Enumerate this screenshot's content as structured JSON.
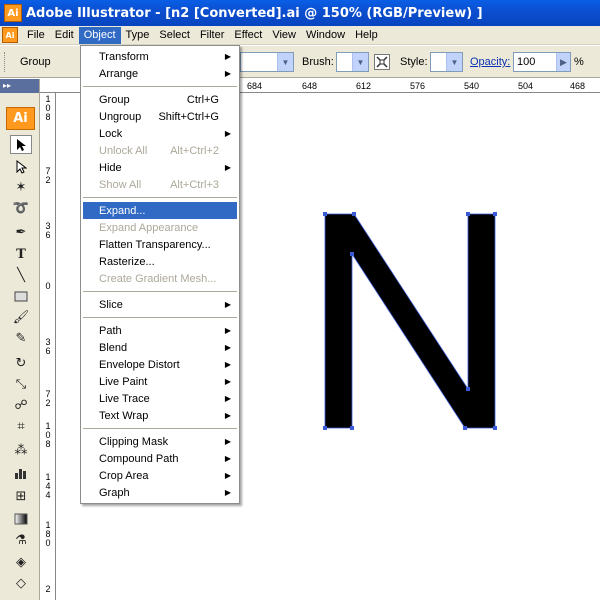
{
  "title": {
    "badge": "Ai",
    "text": "Adobe Illustrator - [n2 [Converted].ai @ 150% (RGB/Preview) ]"
  },
  "menubar": {
    "doc_badge": "Ai",
    "items": [
      "File",
      "Edit",
      "Object",
      "Type",
      "Select",
      "Filter",
      "Effect",
      "View",
      "Window",
      "Help"
    ],
    "active": "Object"
  },
  "controlbar": {
    "selection": "Group",
    "brush_label": "Brush:",
    "style_label": "Style:",
    "opacity_label": "Opacity:",
    "opacity_value": "100",
    "opacity_unit": "%"
  },
  "toolbox": {
    "logo": "Ai"
  },
  "ruler_top": [
    "684",
    "648",
    "612",
    "576",
    "540",
    "504",
    "468"
  ],
  "ruler_left": [
    [
      "1",
      "0",
      "8"
    ],
    [
      "7",
      "2"
    ],
    [
      "3",
      "6"
    ],
    [
      "0"
    ],
    [
      "3",
      "6"
    ],
    [
      "7",
      "2"
    ],
    [
      "1",
      "0",
      "8"
    ],
    [
      "1",
      "4",
      "4"
    ],
    [
      "1",
      "8",
      "0"
    ],
    [
      "2"
    ]
  ],
  "object_menu": {
    "groups": [
      [
        {
          "label": "Transform",
          "submenu": true
        },
        {
          "label": "Arrange",
          "submenu": true
        }
      ],
      [
        {
          "label": "Group",
          "shortcut": "Ctrl+G"
        },
        {
          "label": "Ungroup",
          "shortcut": "Shift+Ctrl+G"
        },
        {
          "label": "Lock",
          "submenu": true
        },
        {
          "label": "Unlock All",
          "shortcut": "Alt+Ctrl+2",
          "disabled": true
        },
        {
          "label": "Hide",
          "submenu": true
        },
        {
          "label": "Show All",
          "shortcut": "Alt+Ctrl+3",
          "disabled": true
        }
      ],
      [
        {
          "label": "Expand...",
          "highlighted": true
        },
        {
          "label": "Expand Appearance",
          "disabled": true
        },
        {
          "label": "Flatten Transparency..."
        },
        {
          "label": "Rasterize..."
        },
        {
          "label": "Create Gradient Mesh...",
          "disabled": true
        }
      ],
      [
        {
          "label": "Slice",
          "submenu": true
        }
      ],
      [
        {
          "label": "Path",
          "submenu": true
        },
        {
          "label": "Blend",
          "submenu": true
        },
        {
          "label": "Envelope Distort",
          "submenu": true
        },
        {
          "label": "Live Paint",
          "submenu": true
        },
        {
          "label": "Live Trace",
          "submenu": true
        },
        {
          "label": "Text Wrap",
          "submenu": true
        }
      ],
      [
        {
          "label": "Clipping Mask",
          "submenu": true
        },
        {
          "label": "Compound Path",
          "submenu": true
        },
        {
          "label": "Crop Area",
          "submenu": true
        },
        {
          "label": "Graph",
          "submenu": true
        }
      ]
    ]
  },
  "colors": {
    "menu_highlight": "#316ac5",
    "anchor_blue": "#3b5bd6",
    "disabled_text": "#aca899",
    "ai_orange": "#ff9a1f"
  },
  "icons": [
    "selection-arrow-icon",
    "direct-selection-icon",
    "magic-wand-icon",
    "lasso-icon",
    "pen-icon",
    "type-icon",
    "line-icon",
    "rectangle-icon",
    "paintbrush-icon",
    "pencil-icon",
    "rotate-icon",
    "scale-icon",
    "warp-icon",
    "free-transform-icon",
    "symbol-sprayer-icon",
    "graph-icon",
    "mesh-icon",
    "gradient-icon",
    "eyedropper-icon",
    "live-paint-icon",
    "chevron-right-icon"
  ]
}
